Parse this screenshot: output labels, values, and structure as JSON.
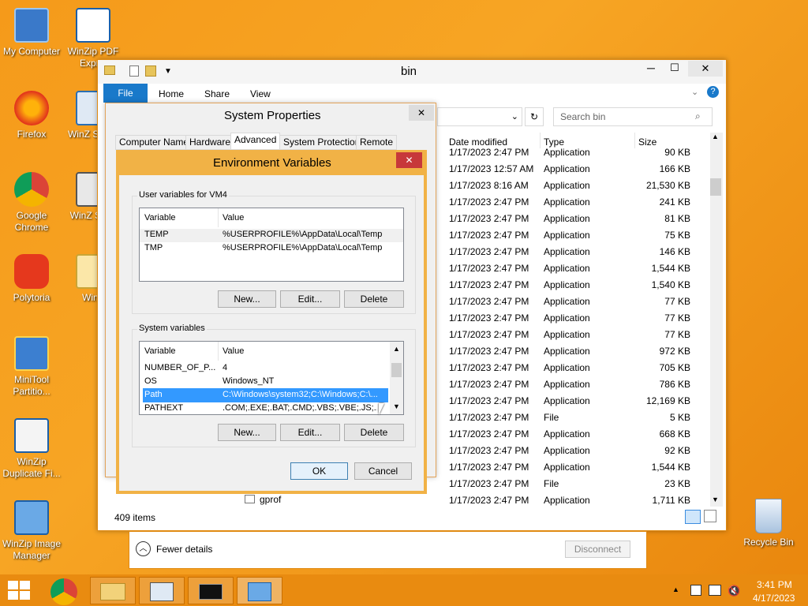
{
  "desktop": {
    "icons": [
      {
        "label": "My Computer",
        "icon": "computer-icon"
      },
      {
        "label": "WinZip PDF Expr...",
        "icon": "pdf-icon"
      },
      {
        "label": "Firefox",
        "icon": "firefox-icon"
      },
      {
        "label": "WinZ SafeS",
        "icon": "winzip-icon"
      },
      {
        "label": "Google Chrome",
        "icon": "chrome-icon"
      },
      {
        "label": "WinZ Secu",
        "icon": "winzip-icon"
      },
      {
        "label": "Polytoria",
        "icon": "polytoria-icon"
      },
      {
        "label": "WinZ",
        "icon": "winzip-icon"
      },
      {
        "label": "MiniTool Partitio...",
        "icon": "minitool-icon"
      },
      {
        "label": "WinZip Duplicate Fi...",
        "icon": "winzip-duplicate-icon"
      },
      {
        "label": "WinZip Image Manager",
        "icon": "winzip-image-icon"
      },
      {
        "label": "Recycle Bin",
        "icon": "recycle-bin-icon"
      }
    ]
  },
  "explorer": {
    "title": "bin",
    "ribbon_tabs": [
      "File",
      "Home",
      "Share",
      "View"
    ],
    "search_placeholder": "Search bin",
    "columns": [
      "Date modified",
      "Type",
      "Size"
    ],
    "rows": [
      {
        "date": "1/17/2023 2:47 PM",
        "type": "Application",
        "size": "90 KB"
      },
      {
        "date": "1/17/2023 12:57 AM",
        "type": "Application",
        "size": "166 KB"
      },
      {
        "date": "1/17/2023 8:16 AM",
        "type": "Application",
        "size": "21,530 KB"
      },
      {
        "date": "1/17/2023 2:47 PM",
        "type": "Application",
        "size": "241 KB"
      },
      {
        "date": "1/17/2023 2:47 PM",
        "type": "Application",
        "size": "81 KB"
      },
      {
        "date": "1/17/2023 2:47 PM",
        "type": "Application",
        "size": "75 KB"
      },
      {
        "date": "1/17/2023 2:47 PM",
        "type": "Application",
        "size": "146 KB"
      },
      {
        "date": "1/17/2023 2:47 PM",
        "type": "Application",
        "size": "1,544 KB"
      },
      {
        "date": "1/17/2023 2:47 PM",
        "type": "Application",
        "size": "1,540 KB"
      },
      {
        "date": "1/17/2023 2:47 PM",
        "type": "Application",
        "size": "77 KB"
      },
      {
        "date": "1/17/2023 2:47 PM",
        "type": "Application",
        "size": "77 KB"
      },
      {
        "date": "1/17/2023 2:47 PM",
        "type": "Application",
        "size": "77 KB"
      },
      {
        "date": "1/17/2023 2:47 PM",
        "type": "Application",
        "size": "972 KB"
      },
      {
        "date": "1/17/2023 2:47 PM",
        "type": "Application",
        "size": "705 KB"
      },
      {
        "date": "1/17/2023 2:47 PM",
        "type": "Application",
        "size": "786 KB"
      },
      {
        "date": "1/17/2023 2:47 PM",
        "type": "Application",
        "size": "12,169 KB"
      },
      {
        "date": "1/17/2023 2:47 PM",
        "type": "File",
        "size": "5 KB"
      },
      {
        "date": "1/17/2023 2:47 PM",
        "type": "Application",
        "size": "668 KB"
      },
      {
        "date": "1/17/2023 2:47 PM",
        "type": "Application",
        "size": "92 KB"
      },
      {
        "date": "1/17/2023 2:47 PM",
        "type": "Application",
        "size": "1,544 KB"
      },
      {
        "date": "1/17/2023 2:47 PM",
        "type": "File",
        "size": "23 KB"
      },
      {
        "date": "1/17/2023 2:47 PM",
        "type": "Application",
        "size": "1,711 KB"
      }
    ],
    "visible_name": "gprof",
    "status": "409 items"
  },
  "sysprops": {
    "title": "System Properties",
    "tabs": [
      "Computer Name",
      "Hardware",
      "Advanced",
      "System Protection",
      "Remote"
    ]
  },
  "envvars": {
    "title": "Environment Variables",
    "user_group": "User variables for VM4",
    "system_group": "System variables",
    "col_variable": "Variable",
    "col_value": "Value",
    "user_rows": [
      {
        "name": "TEMP",
        "value": "%USERPROFILE%\\AppData\\Local\\Temp"
      },
      {
        "name": "TMP",
        "value": "%USERPROFILE%\\AppData\\Local\\Temp"
      }
    ],
    "system_rows": [
      {
        "name": "NUMBER_OF_P...",
        "value": "4"
      },
      {
        "name": "OS",
        "value": "Windows_NT"
      },
      {
        "name": "Path",
        "value": "C:\\Windows\\system32;C:\\Windows;C:\\..."
      },
      {
        "name": "PATHEXT",
        "value": ".COM;.EXE;.BAT;.CMD;.VBS;.VBE;.JS;..."
      }
    ],
    "new": "New...",
    "edit": "Edit...",
    "delete": "Delete",
    "ok": "OK",
    "cancel": "Cancel"
  },
  "rdp": {
    "fewer": "Fewer details",
    "disconnect": "Disconnect"
  },
  "taskbar": {
    "time": "3:41 PM",
    "date": "4/17/2023"
  }
}
